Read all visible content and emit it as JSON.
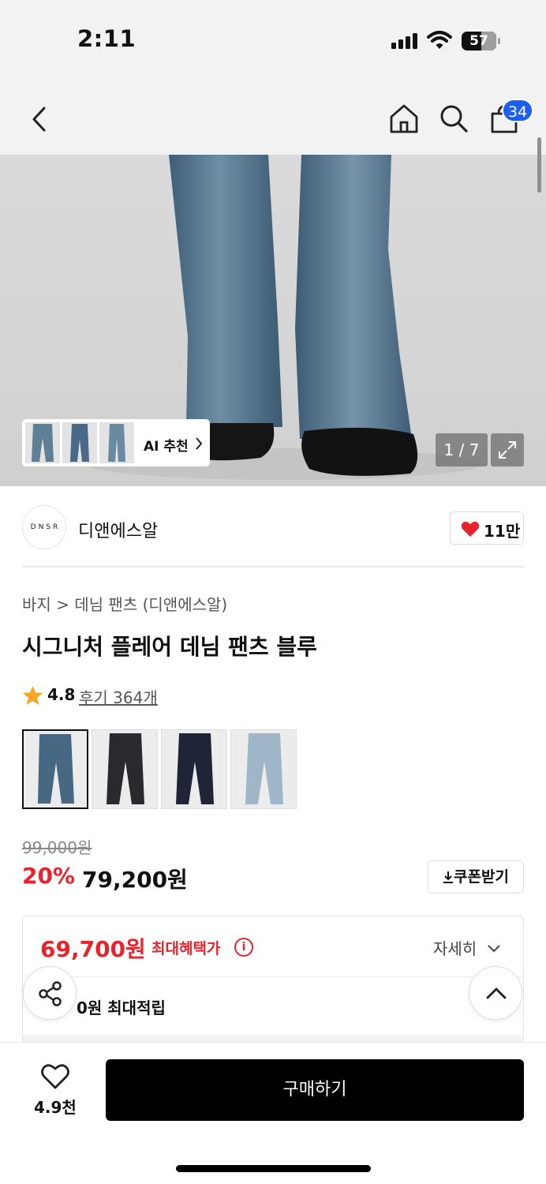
{
  "status_bar": {
    "time": "2:11",
    "battery": "57"
  },
  "nav": {
    "cart_badge": "34",
    "icons": [
      "back-arrow-icon",
      "home-icon",
      "search-icon",
      "cart-icon"
    ]
  },
  "gallery": {
    "ai_label": "AI 추천",
    "counter": "1 / 7"
  },
  "brand": {
    "logo_text": "DNSR",
    "name": "디앤에스알",
    "like_count": "11만"
  },
  "breadcrumb": {
    "text": "바지 > 데님 팬츠 (디앤에스알)"
  },
  "product": {
    "title": "시그니처 플레어 데님 팬츠 블루"
  },
  "rating": {
    "value": "4.8",
    "reviews": "후기 364개"
  },
  "pricing": {
    "original": "99,000원",
    "discount": "20%",
    "sale": "79,200원",
    "coupon_label": "쿠폰받기"
  },
  "benefits": {
    "max_price": "69,700원",
    "max_label": "최대혜택가",
    "detail_label": "자세히",
    "points_text": "0원 최대적립"
  },
  "bottom": {
    "wish_count": "4.9천",
    "buy_label": "구매하기"
  }
}
